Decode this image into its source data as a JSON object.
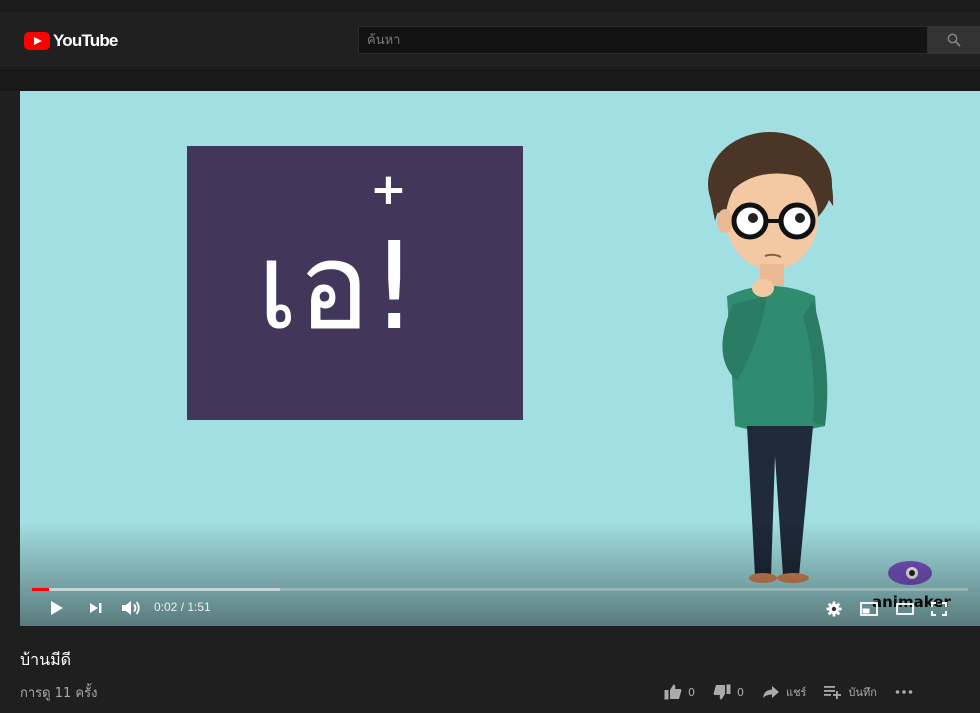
{
  "header": {
    "logo_text": "YouTube",
    "search_placeholder": "ค้นหา"
  },
  "video": {
    "card_plus": "+",
    "card_word": "เอ!",
    "watermark_text": "animaker",
    "time_current": "0:02",
    "time_separator": " / ",
    "time_total": "1:51",
    "progress_fraction": 0.018,
    "buffer_fraction": 0.265
  },
  "info": {
    "title": "บ้านมีดี",
    "views": "การดู 11 ครั้ง",
    "likes": "0",
    "dislikes": "0",
    "share_label": "แชร์",
    "save_label": "บันทึก"
  },
  "colors": {
    "brand": "#ff0000",
    "player_bg": "#a2dfe3",
    "card_bg": "#42375a"
  }
}
